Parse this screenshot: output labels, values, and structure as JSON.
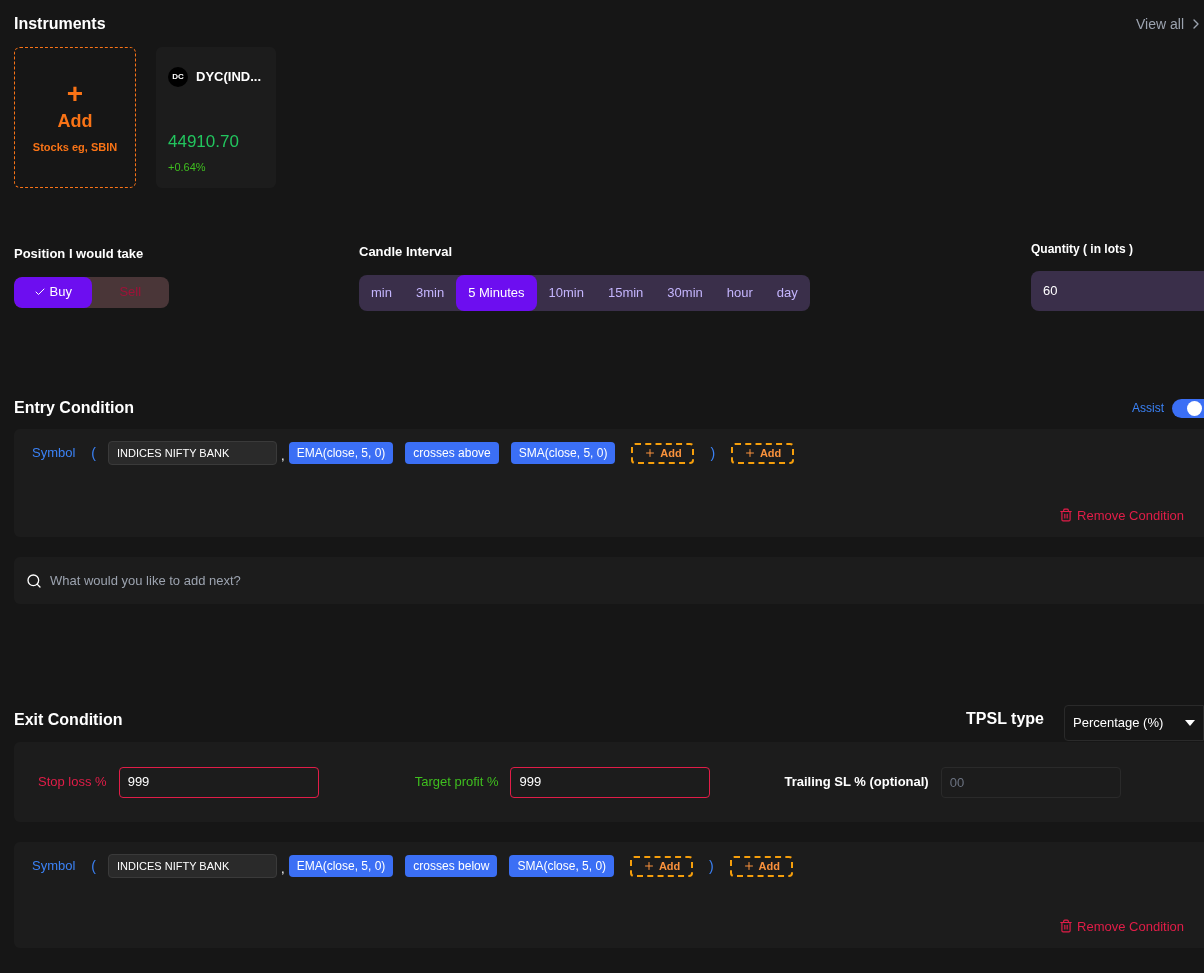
{
  "instruments": {
    "title": "Instruments",
    "view_all": "View all",
    "add_card": {
      "plus": "+",
      "label": "Add",
      "hint": "Stocks eg, SBIN"
    },
    "items": [
      {
        "logo": "DC",
        "name": "DYC(IND...",
        "price": "44910.70",
        "change": "+0.64%"
      }
    ]
  },
  "position": {
    "label": "Position I would take",
    "options": [
      {
        "label": "Buy",
        "selected": true
      },
      {
        "label": "Sell",
        "selected": false
      }
    ]
  },
  "candle_interval": {
    "label": "Candle Interval",
    "options": [
      {
        "label": "min",
        "selected": false
      },
      {
        "label": "3min",
        "selected": false
      },
      {
        "label": "5 Minutes",
        "selected": true
      },
      {
        "label": "10min",
        "selected": false
      },
      {
        "label": "15min",
        "selected": false
      },
      {
        "label": "30min",
        "selected": false
      },
      {
        "label": "hour",
        "selected": false
      },
      {
        "label": "day",
        "selected": false
      }
    ]
  },
  "quantity": {
    "label": "Quantity ( in lots )",
    "value": "60"
  },
  "entry_condition": {
    "title": "Entry Condition",
    "assist": {
      "label": "Assist",
      "on": true
    },
    "tokens": [
      {
        "kind": "label",
        "text": "Symbol"
      },
      {
        "kind": "paren",
        "text": "("
      },
      {
        "kind": "field",
        "text": "INDICES NIFTY BANK"
      },
      {
        "kind": "comma",
        "text": ","
      },
      {
        "kind": "chip",
        "text": "EMA(close, 5, 0)"
      },
      {
        "kind": "chip",
        "text": "crosses above"
      },
      {
        "kind": "chip",
        "text": "SMA(close, 5, 0)"
      },
      {
        "kind": "add",
        "text": "Add"
      },
      {
        "kind": "paren",
        "text": ")"
      },
      {
        "kind": "add",
        "text": "Add"
      }
    ],
    "remove": "Remove Condition",
    "search": {
      "placeholder": "What would you like to add next?"
    }
  },
  "exit_condition": {
    "title": "Exit Condition",
    "tpsl_label": "TPSL type",
    "tpsl_value": "Percentage (%)",
    "stop_loss": {
      "label": "Stop loss %",
      "value": "999"
    },
    "target_profit": {
      "label": "Target profit %",
      "value": "999"
    },
    "trailing_sl": {
      "label": "Trailing SL % (optional)",
      "placeholder": "00"
    },
    "tokens": [
      {
        "kind": "label",
        "text": "Symbol"
      },
      {
        "kind": "paren",
        "text": "("
      },
      {
        "kind": "field",
        "text": "INDICES NIFTY BANK"
      },
      {
        "kind": "comma",
        "text": ","
      },
      {
        "kind": "chip",
        "text": "EMA(close, 5, 0)"
      },
      {
        "kind": "chip",
        "text": "crosses below"
      },
      {
        "kind": "chip",
        "text": "SMA(close, 5, 0)"
      },
      {
        "kind": "add",
        "text": "Add"
      },
      {
        "kind": "paren",
        "text": ")"
      },
      {
        "kind": "add",
        "text": "Add"
      }
    ],
    "remove": "Remove Condition"
  }
}
